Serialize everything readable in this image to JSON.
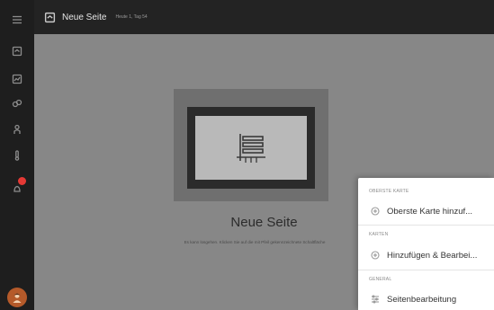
{
  "topbar": {
    "title": "Neue Seite",
    "subtitle": "Heute 1, Tag 54"
  },
  "sidebar": {
    "items": [
      {
        "name": "home-icon"
      },
      {
        "name": "layers-icon"
      },
      {
        "name": "link-icon"
      },
      {
        "name": "person-icon"
      },
      {
        "name": "thermometer-icon"
      },
      {
        "name": "notification-icon",
        "badge": true
      }
    ],
    "avatar": "avatar"
  },
  "main": {
    "heading": "Neue Seite",
    "hint": "Es kann losgehen. Klicken Sie auf die mit Pfeil gekennzeichnete Schaltfläche"
  },
  "popup": {
    "sections": [
      {
        "header": "OBERSTE KARTE",
        "item": {
          "label": "Oberste Karte hinzuf...",
          "icon": "add-circle-icon"
        }
      },
      {
        "header": "KARTEN",
        "item": {
          "label": "Hinzufügen & Bearbei...",
          "icon": "add-circle-icon"
        }
      },
      {
        "header": "GENERAL",
        "item": {
          "label": "Seitenbearbeitung",
          "icon": "list-settings-icon"
        }
      }
    ]
  },
  "colors": {
    "sidebar_bg": "#1e1e1e",
    "topbar_bg": "#232323",
    "main_bg": "#878787",
    "popup_bg": "#ffffff",
    "alert": "#e53935"
  }
}
